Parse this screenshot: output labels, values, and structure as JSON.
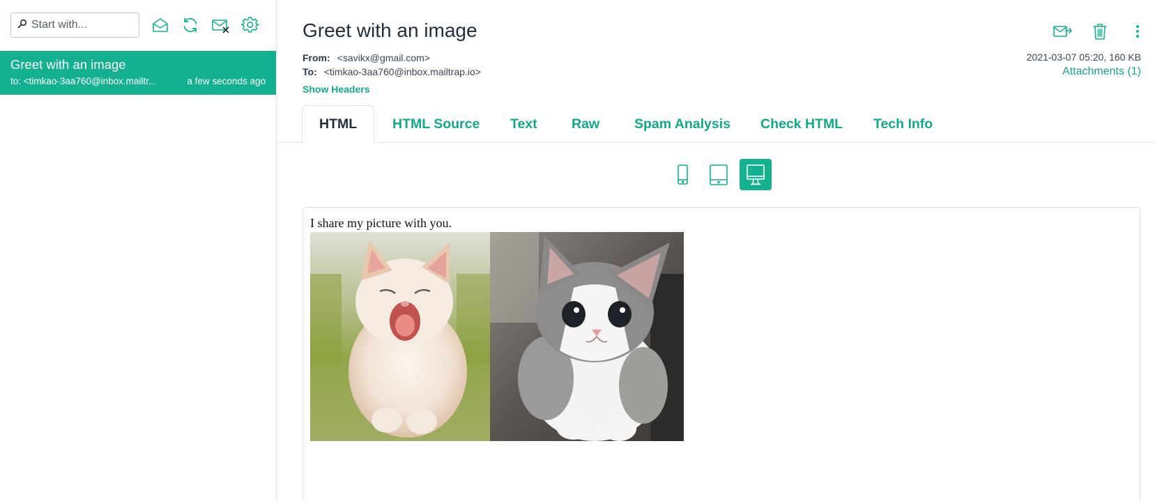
{
  "sidebar": {
    "search": {
      "placeholder": "Start with..."
    },
    "toolbar_icons": [
      "search-icon",
      "mark-read-icon",
      "refresh-icon",
      "clear-inbox-icon",
      "settings-icon"
    ],
    "messages": [
      {
        "subject": "Greet with an image",
        "to": "to: <timkao-3aa760@inbox.mailtr...",
        "time": "a few seconds ago"
      }
    ]
  },
  "message": {
    "subject": "Greet with an image",
    "from_label": "From:",
    "from_value": "<savikx@gmail.com>",
    "to_label": "To:",
    "to_value": "<timkao-3aa760@inbox.mailtrap.io>",
    "show_headers": "Show Headers",
    "date_size": "2021-03-07 05:20, 160 KB",
    "attachments": "Attachments (1)",
    "action_icons": [
      "forward-icon",
      "trash-icon",
      "more-vertical-icon"
    ]
  },
  "tabs": [
    {
      "label": "HTML",
      "active": true
    },
    {
      "label": "HTML Source"
    },
    {
      "label": "Text"
    },
    {
      "label": "Raw"
    },
    {
      "label": "Spam Analysis"
    },
    {
      "label": "Check HTML"
    },
    {
      "label": "Tech Info"
    }
  ],
  "viewports": {
    "icons": [
      "mobile-view-icon",
      "tablet-view-icon",
      "desktop-view-icon"
    ],
    "active": "desktop"
  },
  "preview": {
    "body_text": "I share my picture with you.",
    "images": [
      "kitten-yawning-image",
      "kitten-grey-white-image"
    ]
  },
  "colors": {
    "accent": "#13b190",
    "accent_text": "#13a888",
    "text_dark": "#1f2d3d",
    "border": "#dfe3ea"
  }
}
